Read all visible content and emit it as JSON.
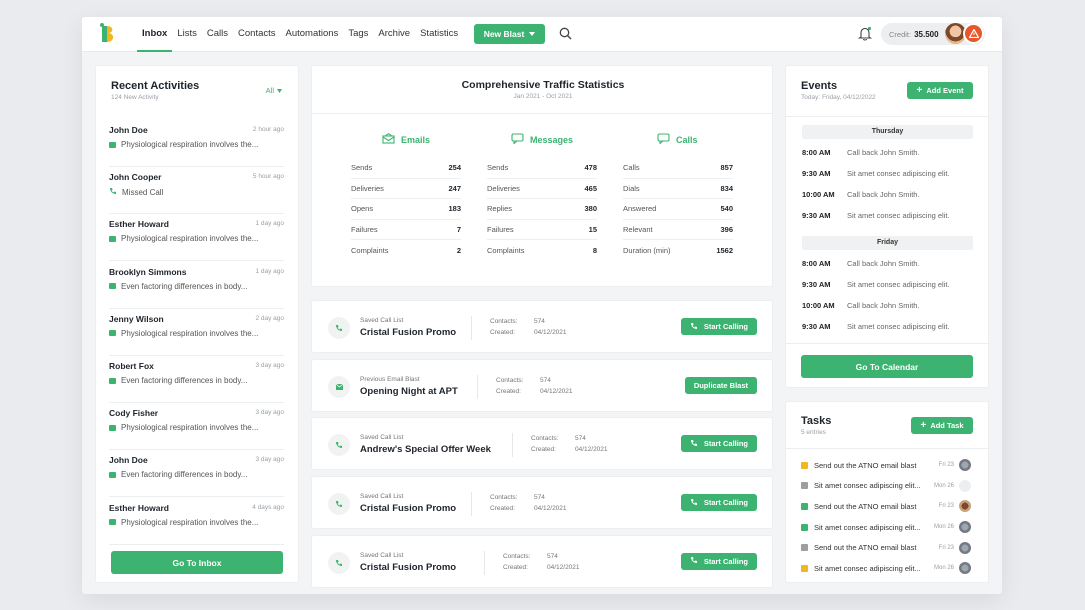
{
  "nav": {
    "items": [
      "Inbox",
      "Lists",
      "Calls",
      "Contacts",
      "Automations",
      "Tags",
      "Archive",
      "Statistics"
    ],
    "new_blast": "New Blast",
    "credit_label": "Credit:",
    "credit_value": "35.500"
  },
  "activities": {
    "title": "Recent Activities",
    "subtitle": "124 New Activity",
    "filter": "All",
    "items": [
      {
        "name": "John Doe",
        "time": "2 hour ago",
        "msg": "Physiological respiration involves the...",
        "kind": "message"
      },
      {
        "name": "John Cooper",
        "time": "5 hour ago",
        "msg": "Missed Call",
        "kind": "call"
      },
      {
        "name": "Esther Howard",
        "time": "1 day ago",
        "msg": "Physiological respiration involves the...",
        "kind": "email"
      },
      {
        "name": "Brooklyn Simmons",
        "time": "1 day ago",
        "msg": "Even factoring differences in body...",
        "kind": "email"
      },
      {
        "name": "Jenny Wilson",
        "time": "2 day ago",
        "msg": "Physiological respiration involves the...",
        "kind": "message"
      },
      {
        "name": "Robert Fox",
        "time": "3 day ago",
        "msg": "Even factoring differences in body...",
        "kind": "email"
      },
      {
        "name": "Cody Fisher",
        "time": "3 day ago",
        "msg": "Physiological respiration involves the...",
        "kind": "message"
      },
      {
        "name": "John Doe",
        "time": "3 day ago",
        "msg": "Even factoring differences in body...",
        "kind": "message"
      },
      {
        "name": "Esther Howard",
        "time": "4 days ago",
        "msg": "Physiological respiration involves the...",
        "kind": "email"
      }
    ],
    "button": "Go To Inbox"
  },
  "stats": {
    "title": "Comprehensive Traffic Statistics",
    "subtitle": "Jan 2021 - Oct 2021",
    "columns": [
      {
        "label": "Emails",
        "rows": [
          [
            "Sends",
            "254"
          ],
          [
            "Deliveries",
            "247"
          ],
          [
            "Opens",
            "183"
          ],
          [
            "Failures",
            "7"
          ],
          [
            "Complaints",
            "2"
          ]
        ]
      },
      {
        "label": "Messages",
        "rows": [
          [
            "Sends",
            "478"
          ],
          [
            "Deliveries",
            "465"
          ],
          [
            "Replies",
            "380"
          ],
          [
            "Failures",
            "15"
          ],
          [
            "Complaints",
            "8"
          ]
        ]
      },
      {
        "label": "Calls",
        "rows": [
          [
            "Calls",
            "857"
          ],
          [
            "Dials",
            "834"
          ],
          [
            "Answered",
            "540"
          ],
          [
            "Relevant",
            "396"
          ],
          [
            "Duration (min)",
            "1562"
          ]
        ]
      }
    ]
  },
  "blasts": [
    {
      "small": "Saved Call List",
      "title": "Cristal Fusion Promo",
      "contacts_label": "Contacts:",
      "contacts": "574",
      "created_label": "Created:",
      "created": "04/12/2021",
      "action": "Start Calling",
      "kind": "call"
    },
    {
      "small": "Previous Email Blast",
      "title": "Opening Night at APT",
      "contacts_label": "Contacts:",
      "contacts": "574",
      "created_label": "Created:",
      "created": "04/12/2021",
      "action": "Duplicate Blast",
      "kind": "email"
    },
    {
      "small": "Saved Call List",
      "title": "Andrew's Special Offer Week",
      "contacts_label": "Contacts:",
      "contacts": "574",
      "created_label": "Created:",
      "created": "04/12/2021",
      "action": "Start Calling",
      "kind": "call"
    },
    {
      "small": "Saved Call List",
      "title": "Cristal Fusion Promo",
      "contacts_label": "Contacts:",
      "contacts": "574",
      "created_label": "Created:",
      "created": "04/12/2021",
      "action": "Start Calling",
      "kind": "call"
    },
    {
      "small": "Saved Call List",
      "title": "Cristal Fusion Promo",
      "contacts_label": "Contacts:",
      "contacts": "574",
      "created_label": "Created:",
      "created": "04/12/2021",
      "action": "Start Calling",
      "kind": "call"
    }
  ],
  "events": {
    "title": "Events",
    "subtitle": "Today: Friday, 04/12/2022",
    "add": "Add Event",
    "days": [
      {
        "day": "Thursday",
        "items": [
          [
            "8:00 AM",
            "Call back John Smith."
          ],
          [
            "9:30 AM",
            "Sit amet consec adipiscing elit."
          ],
          [
            "10:00 AM",
            "Call back John Smith."
          ],
          [
            "9:30 AM",
            "Sit amet consec adipiscing elit."
          ]
        ]
      },
      {
        "day": "Friday",
        "items": [
          [
            "8:00 AM",
            "Call back John Smith."
          ],
          [
            "9:30 AM",
            "Sit amet consec adipiscing elit."
          ],
          [
            "10:00 AM",
            "Call back John Smith."
          ],
          [
            "9:30 AM",
            "Sit amet consec adipiscing elit."
          ]
        ]
      }
    ],
    "button": "Go To Calendar"
  },
  "tasks": {
    "title": "Tasks",
    "subtitle": "5 entries",
    "add": "Add Task",
    "items": [
      {
        "text": "Send out the ATNO email blast",
        "date": "Fri 23",
        "color": "#f2b61f"
      },
      {
        "text": "Sit amet consec adipiscing elit...",
        "date": "Mon 26",
        "color": "#9e9e9e"
      },
      {
        "text": "Send out the ATNO email blast",
        "date": "Fri 23",
        "color": "#3cb371"
      },
      {
        "text": "Sit amet consec adipiscing elit...",
        "date": "Mon 26",
        "color": "#3cb371"
      },
      {
        "text": "Send out the ATNO email blast",
        "date": "Fri 23",
        "color": "#9e9e9e"
      },
      {
        "text": "Sit amet consec adipiscing elit...",
        "date": "Mon 26",
        "color": "#f2b61f"
      }
    ]
  },
  "colors": {
    "accent": "#3cb371"
  }
}
